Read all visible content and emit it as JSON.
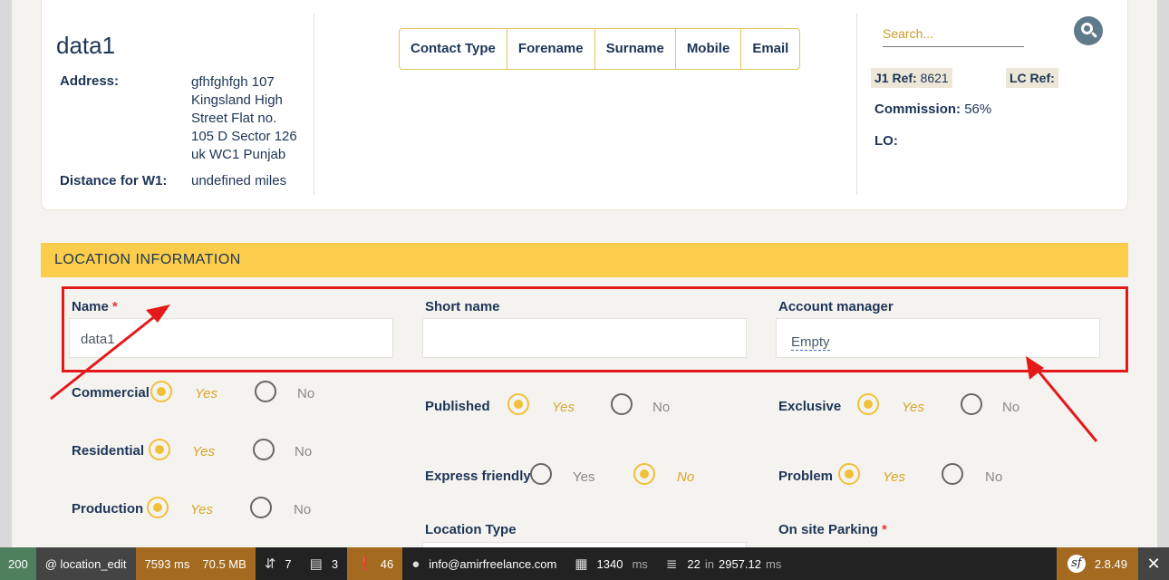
{
  "client": {
    "name": "data1",
    "address_label": "Address:",
    "address_value": "gfhfghfgh 107 Kingsland High Street Flat no. 105 D Sector 126 uk WC1 Punjab",
    "distance_label": "Distance for W1:",
    "distance_value": "undefined miles"
  },
  "contact_table": {
    "headers": [
      "Contact Type",
      "Forename",
      "Surname",
      "Mobile",
      "Email"
    ]
  },
  "search": {
    "placeholder": "Search..."
  },
  "refs": {
    "j1_label": "J1 Ref:",
    "j1_value": "8621",
    "lc_label": "LC Ref:",
    "commission_label": "Commission:",
    "commission_value": "56%",
    "lo_label": "LO:"
  },
  "section": {
    "title": "LOCATION INFORMATION"
  },
  "fields": {
    "name_label": "Name",
    "name_value": "data1",
    "required_mark": "*",
    "short_name_label": "Short name",
    "short_name_value": "",
    "account_manager_label": "Account manager",
    "account_manager_value": "Empty"
  },
  "radios": {
    "yes": "Yes",
    "no": "No",
    "commercial": "Commercial",
    "residential": "Residential",
    "production": "Production",
    "published": "Published",
    "express_friendly": "Express friendly",
    "exclusive": "Exclusive",
    "problem": "Problem"
  },
  "more_fields": {
    "location_type_label": "Location Type",
    "onsite_parking_label": "On site Parking"
  },
  "toolbar": {
    "status": "200",
    "route": "@ location_edit",
    "time": "7593 ms",
    "memory": "70.5 MB",
    "forms": "7",
    "logs": "3",
    "warnings": "46",
    "user": "info@amirfreelance.com",
    "render_time": "1340",
    "render_unit": "ms",
    "db_queries": "22",
    "db_in": "in",
    "db_time": "2957.12",
    "db_unit": "ms",
    "version": "2.8.49",
    "sf_letter": "sf"
  },
  "colors": {
    "accent_yellow": "#fbcd4a",
    "highlight_red": "#e41a1a",
    "navy_text": "#1d3557"
  }
}
